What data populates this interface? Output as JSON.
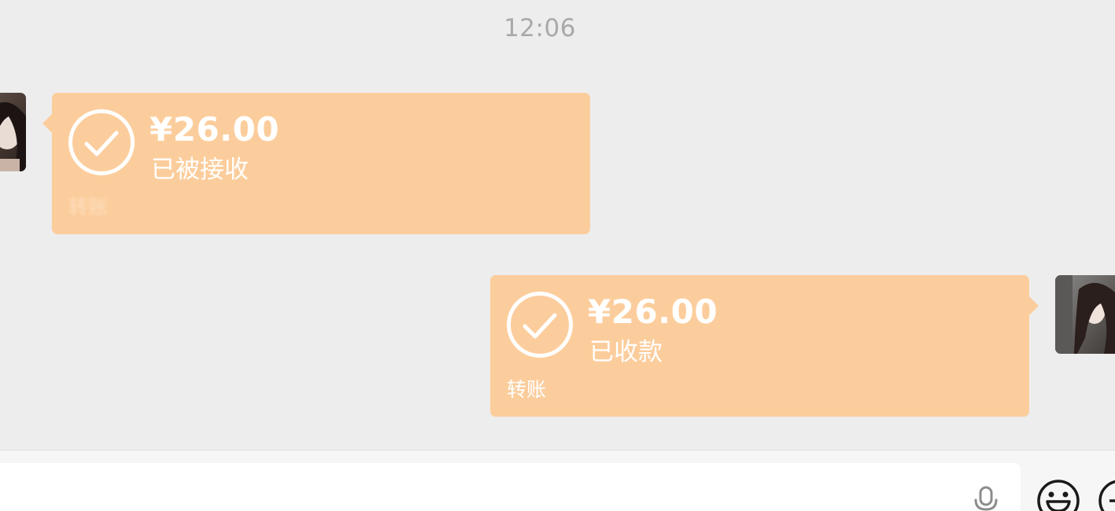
{
  "chat": {
    "timestamp": "12:06",
    "messages": [
      {
        "side": "left",
        "amount": "¥26.00",
        "status": "已被接收",
        "caption": "转账"
      },
      {
        "side": "right",
        "amount": "¥26.00",
        "status": "已收款",
        "caption": "转账"
      }
    ]
  },
  "input_bar": {
    "text_value": "",
    "icons": [
      "microphone-icon",
      "emoji-icon",
      "plus-icon"
    ]
  },
  "colors": {
    "background": "#ededed",
    "transfer_bubble": "#fccd9c",
    "bubble_text": "#ffffff",
    "timestamp_text": "#a9a9a9",
    "input_bar": "#f6f6f6"
  }
}
